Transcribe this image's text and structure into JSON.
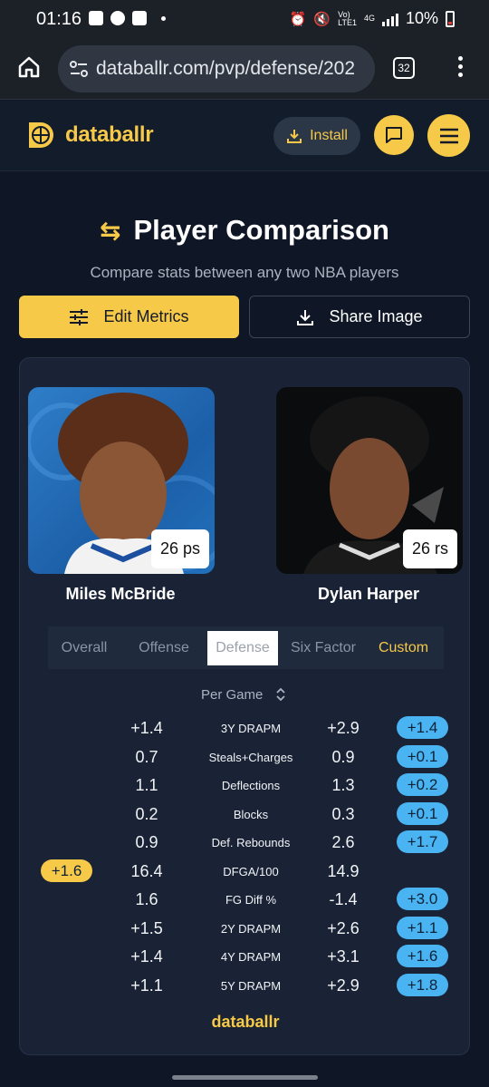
{
  "status_bar": {
    "time": "01:16",
    "network_top": "Vo)",
    "network_bottom": "LTE1",
    "gen": "4G",
    "battery": "10%"
  },
  "browser": {
    "url": "databallr.com/pvp/defense/202",
    "tab_count": "32"
  },
  "site": {
    "brand": "databallr",
    "install_label": "Install",
    "accent": "#f7c948"
  },
  "hero": {
    "title": "Player Comparison",
    "subtitle": "Compare stats between any two NBA players",
    "edit_label": "Edit Metrics",
    "share_label": "Share Image"
  },
  "players": {
    "left": {
      "name": "Miles McBride",
      "badge": "26 ps"
    },
    "right": {
      "name": "Dylan Harper",
      "badge": "26 rs"
    }
  },
  "tabs": [
    {
      "label": "Overall"
    },
    {
      "label": "Offense"
    },
    {
      "label": "Defense"
    },
    {
      "label": "Six Factor"
    },
    {
      "label": "Custom"
    }
  ],
  "active_tab": "Defense",
  "mode_label": "Per Game",
  "stats": [
    {
      "label": "3Y DRAPM",
      "left": "+1.4",
      "right": "+2.9",
      "diff": "+1.4",
      "diff_side": "right"
    },
    {
      "label": "Steals+Charges",
      "left": "0.7",
      "right": "0.9",
      "diff": "+0.1",
      "diff_side": "right"
    },
    {
      "label": "Deflections",
      "left": "1.1",
      "right": "1.3",
      "diff": "+0.2",
      "diff_side": "right"
    },
    {
      "label": "Blocks",
      "left": "0.2",
      "right": "0.3",
      "diff": "+0.1",
      "diff_side": "right"
    },
    {
      "label": "Def. Rebounds",
      "left": "0.9",
      "right": "2.6",
      "diff": "+1.7",
      "diff_side": "right"
    },
    {
      "label": "DFGA/100",
      "left": "16.4",
      "right": "14.9",
      "diff": "+1.6",
      "diff_side": "left"
    },
    {
      "label": "FG Diff %",
      "left": "1.6",
      "right": "-1.4",
      "diff": "+3.0",
      "diff_side": "right"
    },
    {
      "label": "2Y DRAPM",
      "left": "+1.5",
      "right": "+2.6",
      "diff": "+1.1",
      "diff_side": "right"
    },
    {
      "label": "4Y DRAPM",
      "left": "+1.4",
      "right": "+3.1",
      "diff": "+1.6",
      "diff_side": "right"
    },
    {
      "label": "5Y DRAPM",
      "left": "+1.1",
      "right": "+2.9",
      "diff": "+1.8",
      "diff_side": "right"
    }
  ],
  "footer_brand": "databallr"
}
